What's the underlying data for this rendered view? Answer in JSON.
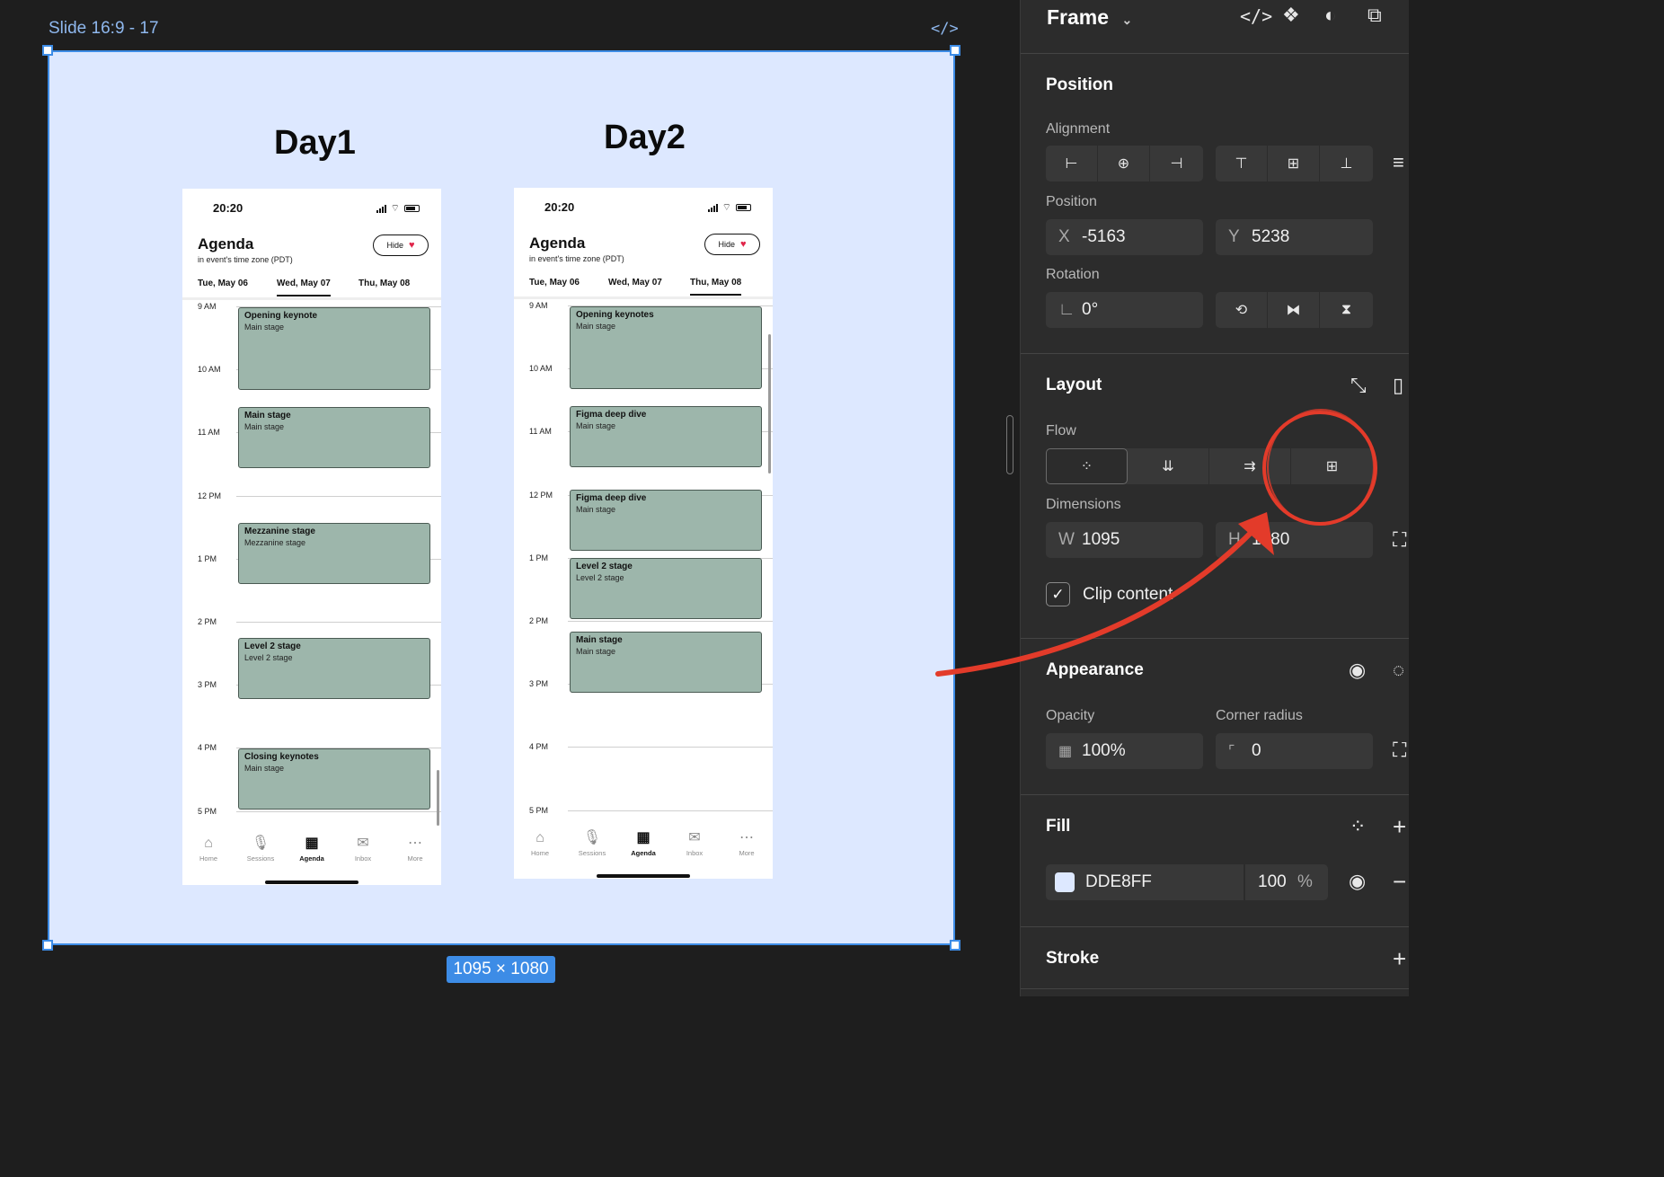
{
  "canvas": {
    "frame_label": "Slide 16:9 - 17",
    "dimensions_badge": "1095 × 1080",
    "code_icon": "</>"
  },
  "slides": [
    {
      "title": "Day1",
      "phone": {
        "time": "20:20",
        "title": "Agenda",
        "subtitle": "in event's time zone (PDT)",
        "hide_label": "Hide",
        "tabs": [
          "Tue, May 06",
          "Wed, May 07",
          "Thu, May 08"
        ],
        "active_tab": 1,
        "hours": [
          "9 AM",
          "10 AM",
          "11 AM",
          "12 PM",
          "1 PM",
          "2 PM",
          "3 PM",
          "4 PM",
          "5 PM"
        ],
        "events": [
          {
            "title": "Opening keynote",
            "stage": "Main stage"
          },
          {
            "title": "Main stage",
            "stage": "Main stage"
          },
          {
            "title": "Mezzanine stage",
            "stage": "Mezzanine stage"
          },
          {
            "title": "Level 2 stage",
            "stage": "Level 2 stage"
          },
          {
            "title": "Closing keynotes",
            "stage": "Main stage"
          }
        ],
        "nav": [
          {
            "label": "Home",
            "icon": "home-icon"
          },
          {
            "label": "Sessions",
            "icon": "microphone-icon"
          },
          {
            "label": "Agenda",
            "icon": "calendar-icon"
          },
          {
            "label": "Inbox",
            "icon": "mail-icon"
          },
          {
            "label": "More",
            "icon": "more-icon"
          }
        ],
        "active_nav": 2
      }
    },
    {
      "title": "Day2",
      "phone": {
        "time": "20:20",
        "title": "Agenda",
        "subtitle": "in event's time zone (PDT)",
        "hide_label": "Hide",
        "tabs": [
          "Tue, May 06",
          "Wed, May 07",
          "Thu, May 08"
        ],
        "active_tab": 2,
        "hours": [
          "9 AM",
          "10 AM",
          "11 AM",
          "12 PM",
          "1 PM",
          "2 PM",
          "3 PM",
          "4 PM",
          "5 PM"
        ],
        "events": [
          {
            "title": "Opening keynotes",
            "stage": "Main stage"
          },
          {
            "title": "Figma deep dive",
            "stage": "Main stage"
          },
          {
            "title": "Figma deep dive",
            "stage": "Main stage"
          },
          {
            "title": "Level 2 stage",
            "stage": "Level 2 stage"
          },
          {
            "title": "Main stage",
            "stage": "Main stage"
          }
        ],
        "nav": [
          {
            "label": "Home",
            "icon": "home-icon"
          },
          {
            "label": "Sessions",
            "icon": "microphone-icon"
          },
          {
            "label": "Agenda",
            "icon": "calendar-icon"
          },
          {
            "label": "Inbox",
            "icon": "mail-icon"
          },
          {
            "label": "More",
            "icon": "more-icon"
          }
        ],
        "active_nav": 2
      }
    }
  ],
  "panel": {
    "header": "Frame",
    "position": {
      "heading": "Position",
      "alignment_label": "Alignment",
      "position_label": "Position",
      "x_label": "X",
      "x_value": "-5163",
      "y_label": "Y",
      "y_value": "5238",
      "rotation_label": "Rotation",
      "rotation_value": "0°"
    },
    "layout": {
      "heading": "Layout",
      "flow_label": "Flow",
      "dimensions_label": "Dimensions",
      "w_label": "W",
      "w_value": "1095",
      "h_label": "H",
      "h_value": "1080",
      "clip_content_label": "Clip content",
      "clip_content_checked": true
    },
    "appearance": {
      "heading": "Appearance",
      "opacity_label": "Opacity",
      "opacity_value": "100%",
      "corner_radius_label": "Corner radius",
      "corner_radius_value": "0"
    },
    "fill": {
      "heading": "Fill",
      "color_hex": "DDE8FF",
      "swatch_color": "#dde8ff",
      "opacity": "100",
      "percent": "%"
    },
    "stroke": {
      "heading": "Stroke"
    }
  },
  "colors": {
    "frame_background": "#dde8ff",
    "selection_blue": "#3d8ce6",
    "event_fill": "#9db6ab",
    "annotation_red": "#e33b2a",
    "panel_background": "#2c2c2c"
  }
}
